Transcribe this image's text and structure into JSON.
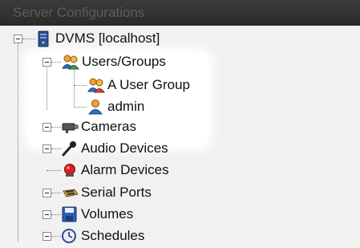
{
  "header": {
    "title": "Server Configurations"
  },
  "tree": {
    "root": {
      "label": "DVMS [localhost]",
      "icon": "server-icon"
    },
    "users_groups": {
      "label": "Users/Groups",
      "icon": "users-groups-icon",
      "children": [
        {
          "label": "A User Group",
          "icon": "user-group-icon"
        },
        {
          "label": "admin",
          "icon": "user-icon"
        }
      ]
    },
    "items": [
      {
        "label": "Cameras",
        "icon": "camera-icon",
        "expandable": true
      },
      {
        "label": "Audio Devices",
        "icon": "microphone-icon",
        "expandable": true
      },
      {
        "label": "Alarm Devices",
        "icon": "alarm-icon",
        "expandable": false
      },
      {
        "label": "Serial Ports",
        "icon": "serial-port-icon",
        "expandable": true
      },
      {
        "label": "Volumes",
        "icon": "floppy-disk-icon",
        "expandable": true
      },
      {
        "label": "Schedules",
        "icon": "clock-icon",
        "expandable": true
      }
    ]
  },
  "colors": {
    "header_bg": "#2f2f2f",
    "header_text": "#5d5d5d",
    "tree_bg": "#f1f1f1",
    "highlight": "#ffffff"
  }
}
